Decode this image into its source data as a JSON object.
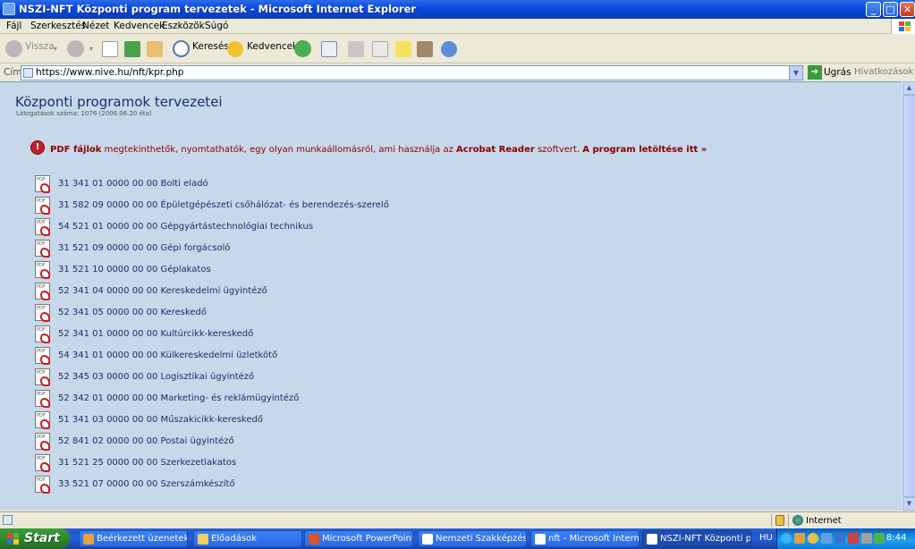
{
  "window": {
    "title": "NSZI-NFT Központi program tervezetek - Microsoft Internet Explorer",
    "min_glyph": "_",
    "max_glyph": "□",
    "close_glyph": "✕"
  },
  "menu": [
    "Fájl",
    "Szerkesztés",
    "Nézet",
    "Kedvencek",
    "Eszközök",
    "Súgó"
  ],
  "toolbar": {
    "back_label": "Vissza",
    "search_label": "Keresés",
    "favorites_label": "Kedvencek"
  },
  "address": {
    "label": "Cím",
    "url": "https://www.nive.hu/nft/kpr.php",
    "go_label": "Ugrás",
    "links_label": "Hivatkozások"
  },
  "page": {
    "title": "Központi programok tervezetei",
    "visits": "Látogatások száma: 1076 (2006.06.20 óta)",
    "notice": {
      "pdf_files": "PDF fájlok",
      "text": " megtekinthetők, nyomtathatók, egy olyan munkaállomásról, ami használja az ",
      "reader": "Acrobat Reader",
      "text2": " szoftvert. ",
      "download_link": "A program letöltése itt »"
    },
    "files": [
      "31 341 01 0000 00 00 Bolti eladó",
      "31 582 09 0000 00 00 Épületgépészeti csőhálózat- és berendezés-szerelő",
      "54 521 01 0000 00 00 Gépgyártástechnológiai technikus",
      "31 521 09 0000 00 00 Gépi forgácsoló",
      "31 521 10 0000 00 00 Géplakatos",
      "52 341 04 0000 00 00 Kereskedelmi ügyintéző",
      "52 341 05 0000 00 00 Kereskedő",
      "52 341 01 0000 00 00 Kultúrcikk-kereskedő",
      "54 341 01 0000 00 00 Külkereskedelmi üzletkötő",
      "52 345 03 0000 00 00 Logisztikai ügyintéző",
      "52 342 01 0000 00 00 Marketing- és reklámügyintéző",
      "51 341 03 0000 00 00 Műszakicikk-kereskedő",
      "52 841 02 0000 00 00 Postai ügyintéző",
      "31 521 25 0000 00 00 Szerkezetlakatos",
      "33 521 07 0000 00 00 Szerszámkészítő"
    ]
  },
  "status": {
    "zone": "Internet"
  },
  "taskbar": {
    "start_label": "Start",
    "tasks": [
      {
        "label": "Beérkezett üzenetek...",
        "color": "#e8a43a"
      },
      {
        "label": "Előadások",
        "color": "#f0d060"
      },
      {
        "label": "Microsoft PowerPoint...",
        "color": "#d9532a"
      },
      {
        "label": "Nemzeti Szakképzési ...",
        "color": "#ffffff"
      },
      {
        "label": "nft - Microsoft Intern...",
        "color": "#ffffff"
      },
      {
        "label": "NSZI-NFT Központi p...",
        "color": "#ffffff"
      }
    ],
    "active_task": 5,
    "language": "HU",
    "clock": "8:44"
  },
  "colors": {
    "page_bg": "#c7d8ea",
    "heading": "#15306b",
    "notice_red": "#8b0000",
    "title_bar": "#0a4be0",
    "start_green": "#2d8a2d"
  }
}
